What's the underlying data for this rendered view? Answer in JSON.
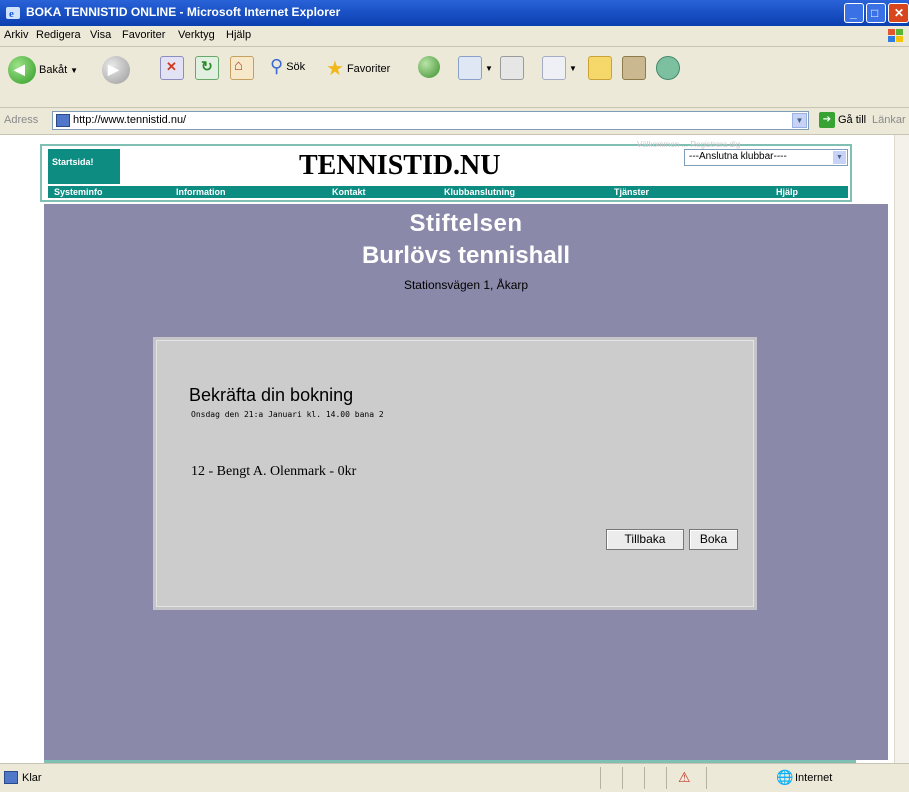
{
  "window": {
    "title": "BOKA TENNISTID ONLINE - Microsoft Internet Explorer"
  },
  "menu": [
    "Arkiv",
    "Redigera",
    "Visa",
    "Favoriter",
    "Verktyg",
    "Hjälp"
  ],
  "toolbar": {
    "back_label": "Bakåt",
    "search_label": "Sök",
    "favorites_label": "Favoriter"
  },
  "address": {
    "label": "Adress",
    "url": "http://www.tennistid.nu/",
    "go_label": "Gå till",
    "links_label": "Länkar"
  },
  "site": {
    "logo": "TENNISTID.NU",
    "startsida": "Startsida!",
    "club_select": "---Anslutna klubbar----",
    "faint_text": "Välkommen ... Registrera dig",
    "nav": [
      "Systeminfo",
      "Information",
      "Kontakt",
      "Klubbanslutning",
      "Tjänster",
      "Hjälp"
    ]
  },
  "venue": {
    "line1": "Stiftelsen",
    "line2": "Burlövs tennishall",
    "address": "Stationsvägen 1, Åkarp"
  },
  "booking": {
    "heading": "Bekräfta din bokning",
    "detail": "Onsdag den 21:a Januari kl. 14.00 bana 2",
    "person": "12 - Bengt A. Olenmark - 0kr",
    "back_button": "Tillbaka",
    "book_button": "Boka"
  },
  "status": {
    "text": "Klar",
    "zone": "Internet"
  },
  "colors": {
    "titlebar": "#1a52c6",
    "chrome": "#ece9d8",
    "teal": "#0d8c82",
    "panel": "#8a89a9",
    "dialog": "#cccccc"
  }
}
